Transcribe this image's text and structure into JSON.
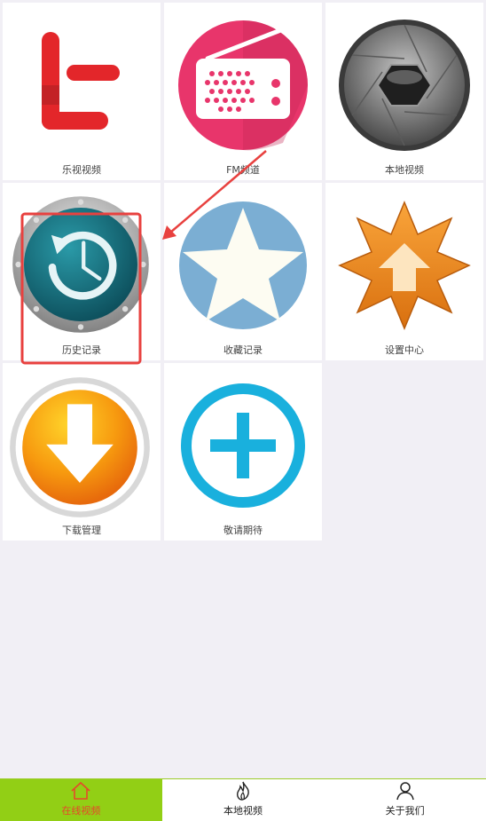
{
  "tiles": [
    {
      "id": "letv",
      "label": "乐视视频",
      "icon": "letv-logo-icon"
    },
    {
      "id": "fm",
      "label": "FM频道",
      "icon": "radio-icon"
    },
    {
      "id": "local",
      "label": "本地视频",
      "icon": "camera-aperture-icon"
    },
    {
      "id": "history",
      "label": "历史记录",
      "icon": "history-clock-icon"
    },
    {
      "id": "favorites",
      "label": "收藏记录",
      "icon": "star-icon"
    },
    {
      "id": "settings",
      "label": "设置中心",
      "icon": "settings-upload-icon"
    },
    {
      "id": "downloads",
      "label": "下载管理",
      "icon": "download-arrow-icon"
    },
    {
      "id": "coming",
      "label": "敬请期待",
      "icon": "plus-circle-icon"
    }
  ],
  "tabbar": {
    "items": [
      {
        "label": "在线视频",
        "icon": "home-icon",
        "active": true
      },
      {
        "label": "本地视频",
        "icon": "flame-icon",
        "active": false
      },
      {
        "label": "关于我们",
        "icon": "user-icon",
        "active": false
      }
    ]
  },
  "colors": {
    "accent": "#92cf15",
    "active_text": "#e6482a",
    "annotation": "#e8413f",
    "background": "#f1eff5"
  }
}
